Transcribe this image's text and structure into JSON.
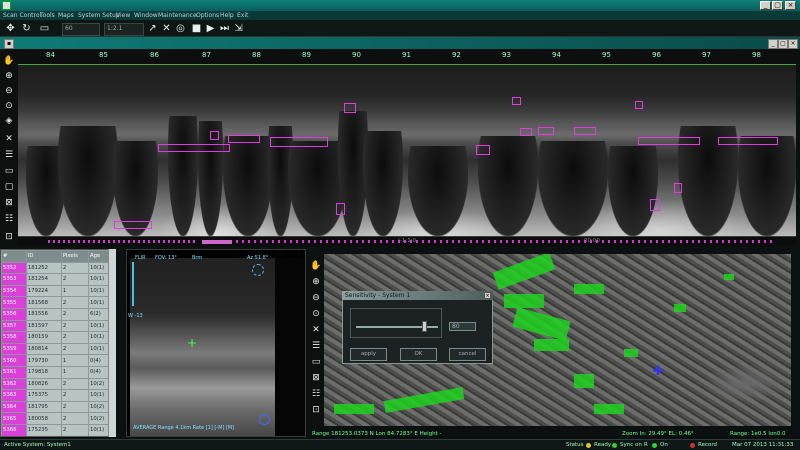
{
  "window": {
    "close_symbol": "×"
  },
  "menu": [
    "Scan Control",
    "Tools",
    "Maps",
    "System Setup",
    "View",
    "Window",
    "Maintenance",
    "Options",
    "Help",
    "Exit"
  ],
  "toolbar": {
    "combo1": "60",
    "combo2": "1:2.1"
  },
  "ruler": {
    "ticks": [
      "84",
      "85",
      "86",
      "87",
      "88",
      "89",
      "90",
      "91",
      "92",
      "93",
      "94",
      "95",
      "96",
      "97",
      "98"
    ]
  },
  "timeline": {
    "label_left": "|-1:1:0",
    "label_right": "00:00"
  },
  "table": {
    "headers": [
      "#",
      "ID",
      "Pixels",
      "Age"
    ],
    "rows": [
      [
        "5352",
        "181252",
        "2",
        "10(1)"
      ],
      [
        "5353",
        "181254",
        "2",
        "10(1)"
      ],
      [
        "5354",
        "179224",
        "1",
        "10(1)"
      ],
      [
        "5355",
        "181568",
        "2",
        "10(1)"
      ],
      [
        "5356",
        "181556",
        "2",
        "6(2)"
      ],
      [
        "5357",
        "181597",
        "2",
        "10(1)"
      ],
      [
        "5358",
        "180159",
        "2",
        "10(1)"
      ],
      [
        "5359",
        "180814",
        "2",
        "10(1)"
      ],
      [
        "5360",
        "179730",
        "1",
        "0(4)"
      ],
      [
        "5361",
        "179818",
        "1",
        "0(4)"
      ],
      [
        "5362",
        "180826",
        "2",
        "10(2)"
      ],
      [
        "5363",
        "175375",
        "2",
        "10(1)"
      ],
      [
        "5364",
        "181795",
        "2",
        "10(2)"
      ],
      [
        "5365",
        "180058",
        "2",
        "10(2)"
      ],
      [
        "5366",
        "175235",
        "2",
        "10(1)"
      ],
      [
        "5367",
        "181036",
        "2",
        "10(1)"
      ],
      [
        "5368",
        "178849",
        "2",
        "10(1)"
      ]
    ]
  },
  "camera": {
    "mode": "FLIR",
    "fov": "FOV: 13°",
    "range": "Brm",
    "az": "Az 51.8°",
    "el": "W -13",
    "bottom": "AVERAGE  Range 4.1km  Rate [1] [-M] [M]"
  },
  "dialog": {
    "title": "Sensitivity - System 1",
    "value": "80",
    "apply": "apply",
    "ok": "OK",
    "cancel": "cancel"
  },
  "map_status": {
    "coords": "Range 181253.0373 N   Lon 84.7283° E   Height -",
    "zoom": "Zoom In: 29.49°  EL: 0.46°",
    "range": "Range: 1e0.5  lon0.0"
  },
  "status": {
    "left": "Active System: System1",
    "items": [
      "Status",
      "Ready",
      "Sync on",
      "R",
      "On",
      "Record"
    ],
    "date": "Mar 07 2013  11:31:33"
  },
  "colors": {
    "accent": "#0f7f7a",
    "track": "#e23be2",
    "vegetation": "#1ed21e"
  }
}
